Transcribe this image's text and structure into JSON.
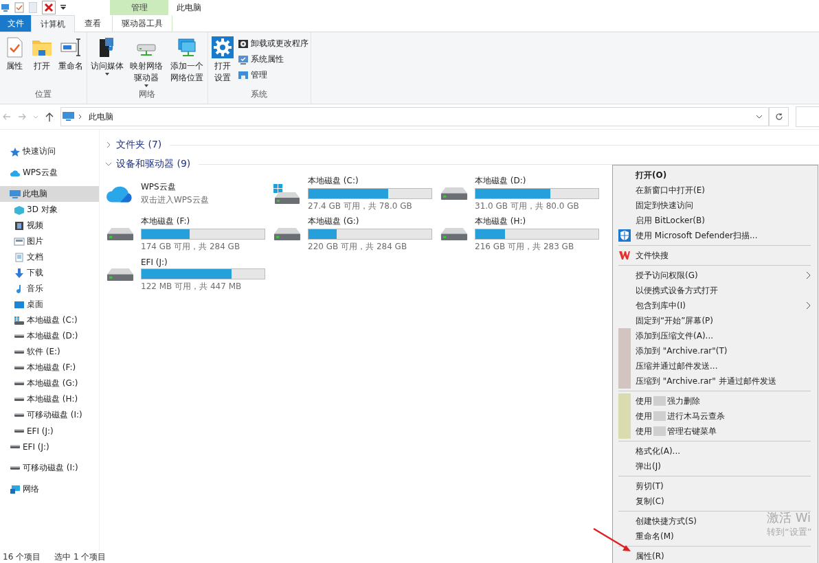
{
  "window": {
    "title": "此电脑",
    "context_tab_header": "管理"
  },
  "ribbon_tabs": [
    {
      "label": "文件",
      "kind": "file",
      "selected": false
    },
    {
      "label": "计算机",
      "kind": "tab",
      "selected": true
    },
    {
      "label": "查看",
      "kind": "tab",
      "selected": false
    },
    {
      "label": "驱动器工具",
      "kind": "context",
      "selected": false
    }
  ],
  "ribbon_groups": [
    {
      "name": "位置",
      "buttons": [
        {
          "label": "属性",
          "kind": "properties",
          "dropdown": false
        },
        {
          "label": "打开",
          "kind": "folder",
          "dropdown": false
        },
        {
          "label": "重命名",
          "kind": "rename",
          "dropdown": false
        }
      ]
    },
    {
      "name": "网络",
      "buttons": [
        {
          "label": "访问媒体",
          "kind": "media",
          "dropdown": true
        },
        {
          "label": "映射网络驱动器",
          "kind": "netdrive",
          "dropdown": true
        },
        {
          "label": "添加一个网络位置",
          "kind": "netloc",
          "dropdown": false
        }
      ]
    },
    {
      "name": "系统",
      "buttons": [
        {
          "label": "打开设置",
          "kind": "settings",
          "dropdown": false
        }
      ],
      "small_buttons": [
        {
          "label": "卸载或更改程序",
          "kind": "uninstall"
        },
        {
          "label": "系统属性",
          "kind": "sysprops"
        },
        {
          "label": "管理",
          "kind": "manage"
        }
      ]
    }
  ],
  "address_bar": {
    "path": "此电脑"
  },
  "sidebar": {
    "items": [
      {
        "label": "快速访问",
        "kind": "star",
        "selected": false
      },
      {
        "label": "WPS云盘",
        "kind": "cloud",
        "selected": false
      },
      {
        "label": "此电脑",
        "kind": "computer",
        "selected": true,
        "children": [
          {
            "label": "3D 对象",
            "kind": "cube",
            "selected": false
          },
          {
            "label": "视频",
            "kind": "video",
            "selected": false
          },
          {
            "label": "图片",
            "kind": "picture",
            "selected": false
          },
          {
            "label": "文档",
            "kind": "document",
            "selected": false
          },
          {
            "label": "下载",
            "kind": "download",
            "selected": false
          },
          {
            "label": "音乐",
            "kind": "music",
            "selected": false
          },
          {
            "label": "桌面",
            "kind": "desktop",
            "selected": false
          },
          {
            "label": "本地磁盘 (C:)",
            "kind": "system-drive",
            "selected": false
          },
          {
            "label": "本地磁盘 (D:)",
            "kind": "drive",
            "selected": false
          },
          {
            "label": "软件 (E:)",
            "kind": "drive",
            "selected": false
          },
          {
            "label": "本地磁盘 (F:)",
            "kind": "drive",
            "selected": false
          },
          {
            "label": "本地磁盘 (G:)",
            "kind": "drive",
            "selected": false
          },
          {
            "label": "本地磁盘 (H:)",
            "kind": "drive",
            "selected": false
          },
          {
            "label": "可移动磁盘 (I:)",
            "kind": "drive",
            "selected": false
          },
          {
            "label": "EFI (J:)",
            "kind": "drive",
            "selected": false
          }
        ]
      },
      {
        "label": "EFI (J:)",
        "kind": "drive",
        "selected": false
      },
      {
        "label": "可移动磁盘 (I:)",
        "kind": "drive",
        "selected": false
      },
      {
        "label": "网络",
        "kind": "network",
        "selected": false
      }
    ]
  },
  "sections": [
    {
      "title": "文件夹 (7)",
      "expanded": false
    },
    {
      "title": "设备和驱动器 (9)",
      "expanded": true
    }
  ],
  "drives": [
    {
      "name": "WPS云盘",
      "kind": "cloud",
      "caption": "双击进入WPS云盘"
    },
    {
      "name": "本地磁盘 (C:)",
      "kind": "system-drive",
      "level": 0.65,
      "caption": "27.4 GB 可用，共 78.0 GB"
    },
    {
      "name": "本地磁盘 (D:)",
      "kind": "drive",
      "level": 0.61,
      "caption": "31.0 GB 可用，共 80.0 GB"
    },
    {
      "name": "本地磁盘 (F:)",
      "kind": "drive",
      "level": 0.39,
      "caption": "174 GB 可用，共 284 GB"
    },
    {
      "name": "本地磁盘 (G:)",
      "kind": "drive",
      "level": 0.23,
      "caption": "220 GB 可用，共 284 GB"
    },
    {
      "name": "本地磁盘 (H:)",
      "kind": "drive",
      "level": 0.24,
      "caption": "216 GB 可用，共 283 GB"
    },
    {
      "name": "EFI (J:)",
      "kind": "drive",
      "level": 0.73,
      "caption": "122 MB 可用，共 447 MB"
    }
  ],
  "context_menu": [
    {
      "kind": "plain",
      "label": "打开(O)",
      "bold": true,
      "submenu": false
    },
    {
      "kind": "plain",
      "label": "在新窗口中打开(E)",
      "bold": false,
      "submenu": false
    },
    {
      "kind": "plain",
      "label": "固定到快速访问",
      "bold": false,
      "submenu": false
    },
    {
      "kind": "plain",
      "label": "启用 BitLocker(B)",
      "bold": false,
      "submenu": false
    },
    {
      "kind": "defender",
      "label": "使用 Microsoft Defender扫描...",
      "bold": false,
      "submenu": false
    },
    {
      "kind": "separator"
    },
    {
      "kind": "wps",
      "label": "文件快搜",
      "bold": false,
      "submenu": false
    },
    {
      "kind": "separator"
    },
    {
      "kind": "plain",
      "label": "授予访问权限(G)",
      "bold": false,
      "submenu": true
    },
    {
      "kind": "plain",
      "label": "以便携式设备方式打开",
      "bold": false,
      "submenu": false
    },
    {
      "kind": "plain",
      "label": "包含到库中(I)",
      "bold": false,
      "submenu": true
    },
    {
      "kind": "plain",
      "label": "固定到“开始”屏幕(P)",
      "bold": false,
      "submenu": false
    },
    {
      "kind": "archiver",
      "label": "添加到压缩文件(A)...",
      "bold": false,
      "submenu": false
    },
    {
      "kind": "archiver",
      "label": "添加到 \"Archive.rar\"(T)",
      "bold": false,
      "submenu": false
    },
    {
      "kind": "archiver",
      "label": "压缩并通过邮件发送...",
      "bold": false,
      "submenu": false
    },
    {
      "kind": "archiver",
      "label": "压缩到 \"Archive.rar\" 并通过邮件发送",
      "bold": false,
      "submenu": false
    },
    {
      "kind": "separator"
    },
    {
      "kind": "tool",
      "label": "使用",
      "tail": "强力删除",
      "bold": false,
      "submenu": false
    },
    {
      "kind": "tool",
      "label": "使用",
      "tail": "进行木马云查杀",
      "bold": false,
      "submenu": false
    },
    {
      "kind": "tool",
      "label": "使用",
      "tail": "管理右键菜单",
      "bold": false,
      "submenu": false
    },
    {
      "kind": "separator"
    },
    {
      "kind": "plain",
      "label": "格式化(A)...",
      "bold": false,
      "submenu": false
    },
    {
      "kind": "plain",
      "label": "弹出(J)",
      "bold": false,
      "submenu": false
    },
    {
      "kind": "separator"
    },
    {
      "kind": "plain",
      "label": "剪切(T)",
      "bold": false,
      "submenu": false
    },
    {
      "kind": "plain",
      "label": "复制(C)",
      "bold": false,
      "submenu": false
    },
    {
      "kind": "separator"
    },
    {
      "kind": "plain",
      "label": "创建快捷方式(S)",
      "bold": false,
      "submenu": false
    },
    {
      "kind": "plain",
      "label": "重命名(M)",
      "bold": false,
      "submenu": false
    },
    {
      "kind": "separator"
    },
    {
      "kind": "plain",
      "label": "属性(R)",
      "bold": false,
      "submenu": false
    }
  ],
  "activation_notice": {
    "title": "激活 Wi",
    "subtitle": "转到“设置”"
  },
  "status_bar": {
    "count": "16 个项目",
    "selection": "选中 1 个项目"
  }
}
